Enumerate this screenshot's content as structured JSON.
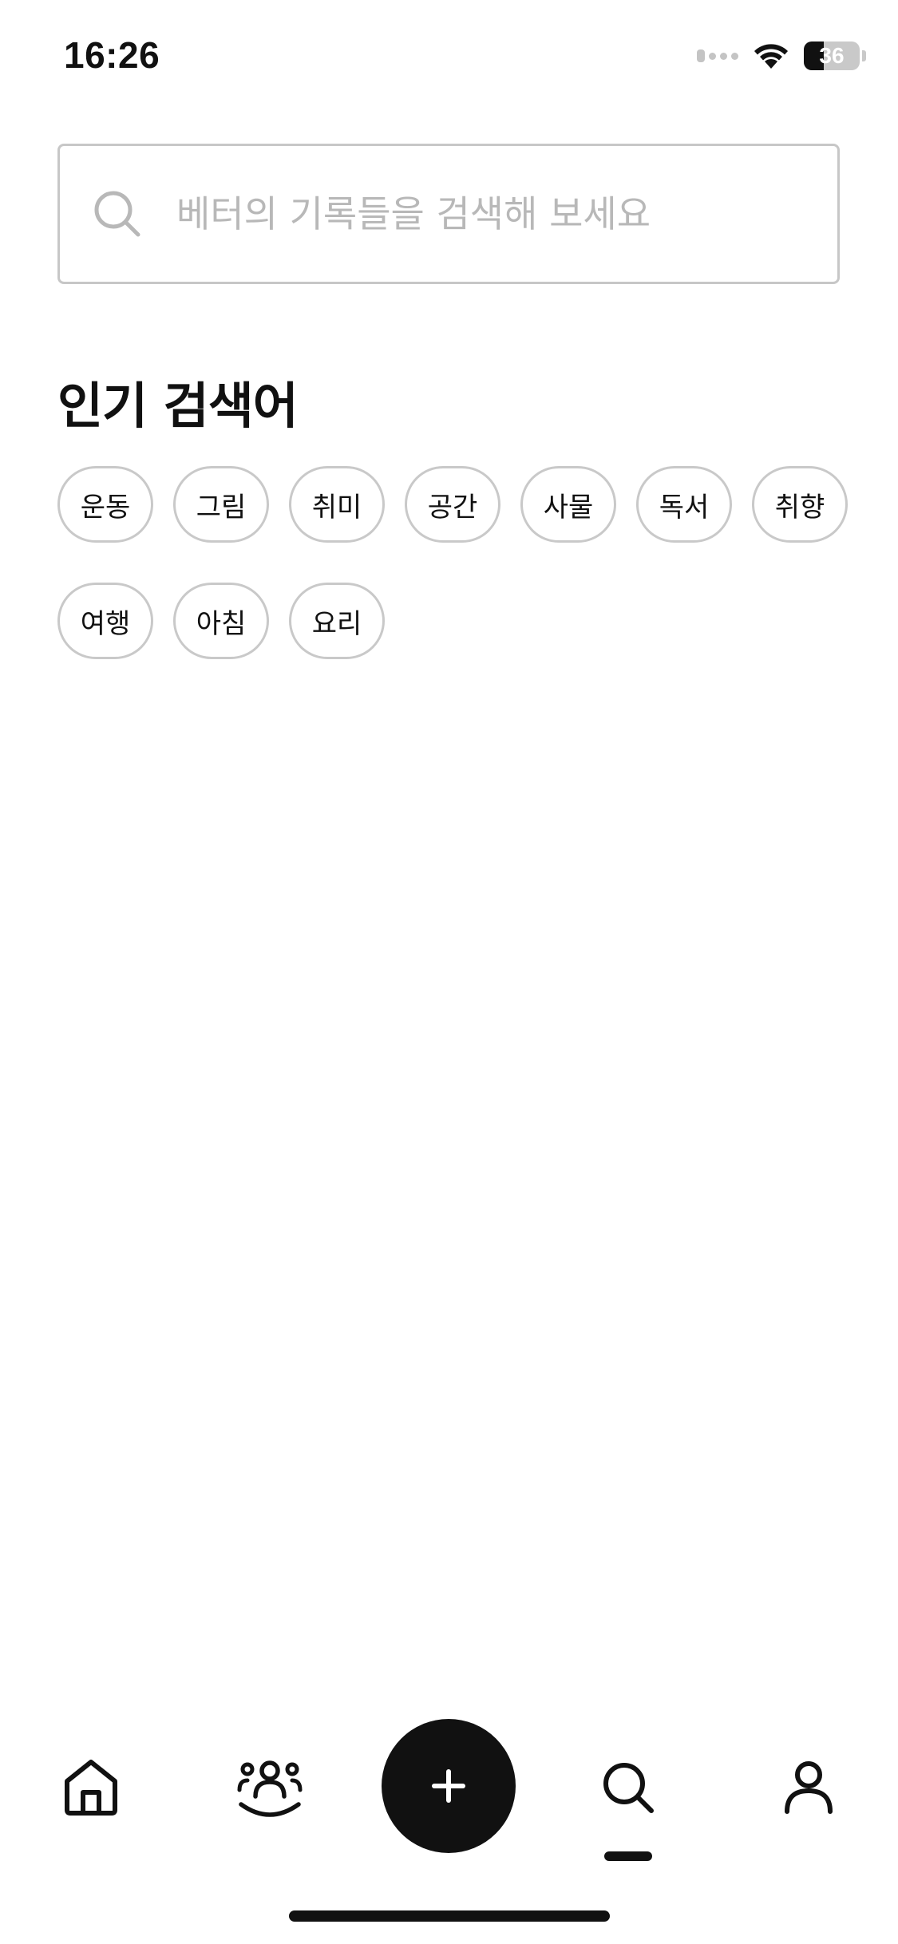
{
  "status_bar": {
    "time": "16:26",
    "battery_level": "36",
    "battery_fraction": 0.36
  },
  "search": {
    "placeholder": "베터의 기록들을 검색해 보세요",
    "value": "",
    "icon": "search-icon"
  },
  "popular": {
    "title": "인기 검색어",
    "keywords": [
      "운동",
      "그림",
      "취미",
      "공간",
      "사물",
      "독서",
      "취향",
      "여행",
      "아침",
      "요리"
    ]
  },
  "bottom_nav": {
    "items": [
      {
        "id": "home",
        "icon": "home-icon"
      },
      {
        "id": "community",
        "icon": "people-icon"
      },
      {
        "id": "add",
        "icon": "plus-icon"
      },
      {
        "id": "search",
        "icon": "search-icon",
        "active": true
      },
      {
        "id": "profile",
        "icon": "user-icon"
      }
    ]
  },
  "colors": {
    "text": "#111111",
    "border": "#c7c7c7",
    "placeholder": "#b8b8b8",
    "accent": "#111111",
    "background": "#ffffff"
  }
}
